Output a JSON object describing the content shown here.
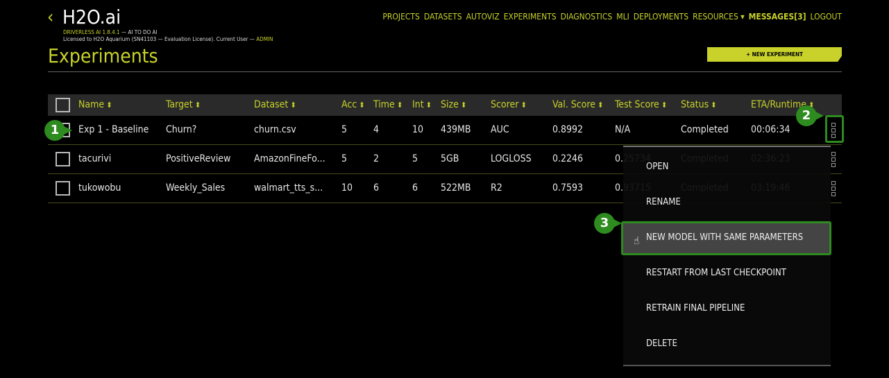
{
  "header": {
    "back_icon": "chevron-left-icon",
    "logo": "H2O.ai",
    "version": "DRIVERLESS AI 1.8.4.1",
    "tagline": " — AI TO DO AI",
    "license": "Licensed to H2O Aquarium (SN41103 — Evaluation License). Current User — ",
    "user": "ADMIN"
  },
  "nav": [
    "PROJECTS",
    "DATASETS",
    "AUTOVIZ",
    "EXPERIMENTS",
    "DIAGNOSTICS",
    "MLI",
    "DEPLOYMENTS",
    "RESOURCES ▾",
    "MESSAGES[3]",
    "LOGOUT"
  ],
  "page": {
    "title": "Experiments",
    "new_button": "+ NEW EXPERIMENT"
  },
  "table": {
    "columns": [
      "Name",
      "Target",
      "Dataset",
      "Acc",
      "Time",
      "Int",
      "Size",
      "Scorer",
      "Val. Score",
      "Test Score",
      "Status",
      "ETA/Runtime"
    ],
    "rows": [
      [
        "Exp 1 - Baseline",
        "Churn?",
        "churn.csv",
        "5",
        "4",
        "10",
        "439MB",
        "AUC",
        "0.8992",
        "N/A",
        "Completed",
        "00:06:34"
      ],
      [
        "tacurivi",
        "PositiveReview",
        "AmazonFineFo...",
        "5",
        "2",
        "5",
        "5GB",
        "LOGLOSS",
        "0.2246",
        "0.25734",
        "Completed",
        "02:36:23"
      ],
      [
        "tukowobu",
        "Weekly_Sales",
        "walmart_tts_s...",
        "10",
        "6",
        "6",
        "522MB",
        "R2",
        "0.7593",
        "0.93715",
        "Completed",
        "03:19:46"
      ]
    ]
  },
  "menu": [
    "OPEN",
    "RENAME",
    "NEW MODEL WITH SAME PARAMETERS",
    "RESTART FROM LAST CHECKPOINT",
    "RETRAIN FINAL PIPELINE",
    "DELETE"
  ],
  "callouts": [
    "1",
    "2",
    "3"
  ],
  "colors": {
    "accent": "#c8d22a",
    "callout": "#2e8b1f"
  }
}
